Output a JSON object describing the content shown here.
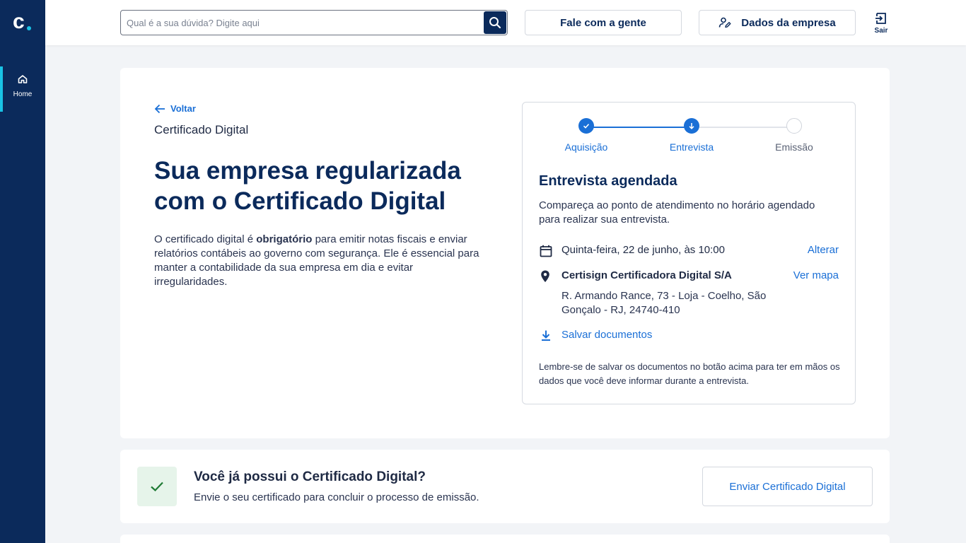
{
  "sidebar": {
    "logo_letter": "c",
    "nav": [
      {
        "label": "Home",
        "icon": "home-icon",
        "active": true
      }
    ]
  },
  "topbar": {
    "search_placeholder": "Qual é a sua dúvida? Digite aqui",
    "search_icon": "search-icon",
    "contact_label": "Fale com a gente",
    "company_label": "Dados da empresa",
    "company_icon": "user-edit-icon",
    "logout_label": "Sair",
    "logout_icon": "logout-icon"
  },
  "main": {
    "back_label": "Voltar",
    "breadcrumb": "Certificado Digital",
    "headline": "Sua empresa regularizada com o Certificado Digital",
    "description_pre": "O certificado digital é ",
    "description_bold": "obrigatório",
    "description_post": " para emitir notas fiscais e enviar relatórios contábeis ao governo com segurança. Ele é essencial para manter a contabilidade da sua empresa em dia e evitar irregularidades."
  },
  "appointment": {
    "steps": [
      {
        "label": "Aquisição",
        "status": "done"
      },
      {
        "label": "Entrevista",
        "status": "current"
      },
      {
        "label": "Emissão",
        "status": "pending"
      }
    ],
    "title": "Entrevista agendada",
    "subtitle": "Compareça ao ponto de atendimento no horário agendado para realizar sua entrevista.",
    "date_text": "Quinta-feira, 22 de junho, às 10:00",
    "change_label": "Alterar",
    "place_name": "Certisign Certificadora Digital S/A",
    "map_label": "Ver mapa",
    "address": "R. Armando Rance, 73 - Loja - Coelho, São Gonçalo - RJ, 24740-410",
    "save_label": "Salvar documentos",
    "note": "Lembre-se de salvar os documentos no botão acima para ter em mãos os dados que você deve informar durante a entrevista."
  },
  "upload_card": {
    "title": "Você já possui o Certificado Digital?",
    "subtitle": "Envie o seu certificado para concluir o processo de emissão.",
    "button_label": "Enviar Certificado Digital"
  },
  "colors": {
    "sidebar": "#0b2a5b",
    "accent": "#1a6fd6",
    "highlight": "#19c3e6",
    "success_bg": "#e6f4ea",
    "success": "#1e7a34"
  }
}
